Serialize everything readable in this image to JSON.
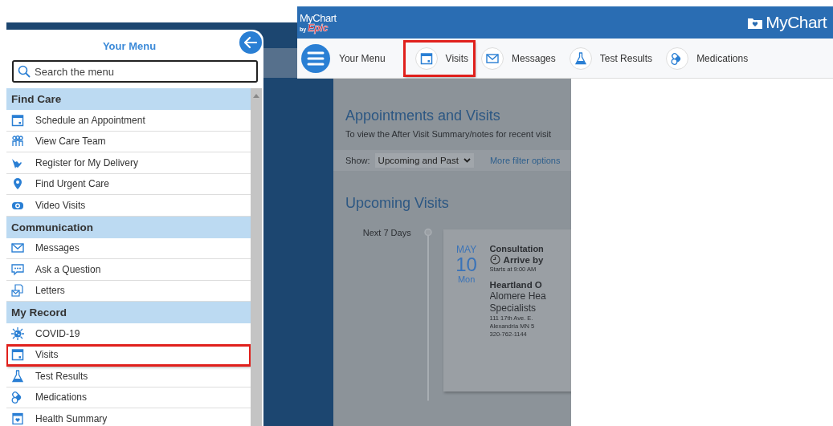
{
  "menu_panel": {
    "title": "Your Menu",
    "search": {
      "placeholder": "Search the menu"
    },
    "sections": [
      {
        "heading": "Find Care",
        "items": [
          {
            "label": "Schedule an Appointment",
            "highlighted": false
          },
          {
            "label": "View Care Team",
            "highlighted": false
          },
          {
            "label": "Register for My Delivery",
            "highlighted": false
          },
          {
            "label": "Find Urgent Care",
            "highlighted": false
          },
          {
            "label": "Video Visits",
            "highlighted": false
          }
        ]
      },
      {
        "heading": "Communication",
        "items": [
          {
            "label": "Messages",
            "highlighted": false
          },
          {
            "label": "Ask a Question",
            "highlighted": false
          },
          {
            "label": "Letters",
            "highlighted": false
          }
        ]
      },
      {
        "heading": "My Record",
        "items": [
          {
            "label": "COVID-19",
            "highlighted": false
          },
          {
            "label": "Visits",
            "highlighted": true
          },
          {
            "label": "Test Results",
            "highlighted": false
          },
          {
            "label": "Medications",
            "highlighted": false
          },
          {
            "label": "Health Summary",
            "highlighted": false
          }
        ]
      }
    ]
  },
  "header": {
    "logo": "MyChart",
    "logo_by": "by",
    "logo_epic": "Epic",
    "brand": "MyChart"
  },
  "nav": [
    {
      "label": "Your Menu",
      "highlighted": false
    },
    {
      "label": "Visits",
      "highlighted": true
    },
    {
      "label": "Messages",
      "highlighted": false
    },
    {
      "label": "Test Results",
      "highlighted": false
    },
    {
      "label": "Medications",
      "highlighted": false
    }
  ],
  "page": {
    "title": "Appointments and Visits",
    "intro": "To view the After Visit Summary/notes for recent visit",
    "filter": {
      "label": "Show:",
      "value": "Upcoming and Past"
    },
    "more_filters": "More filter options",
    "section": "Upcoming Visits",
    "group": "Next 7 Days",
    "appointment": {
      "month": "MAY",
      "day": "10",
      "weekday": "Mon",
      "type": "Consultation",
      "arrive": "Arrive by",
      "starts": "Starts at 9:00 AM",
      "department": "Heartland O",
      "facility": "Alomere Hea",
      "facility_2": "Specialists",
      "address_1": "111 17th Ave. E.",
      "address_2": "Alexandria MN 5",
      "phone": "320-762-1144"
    }
  }
}
